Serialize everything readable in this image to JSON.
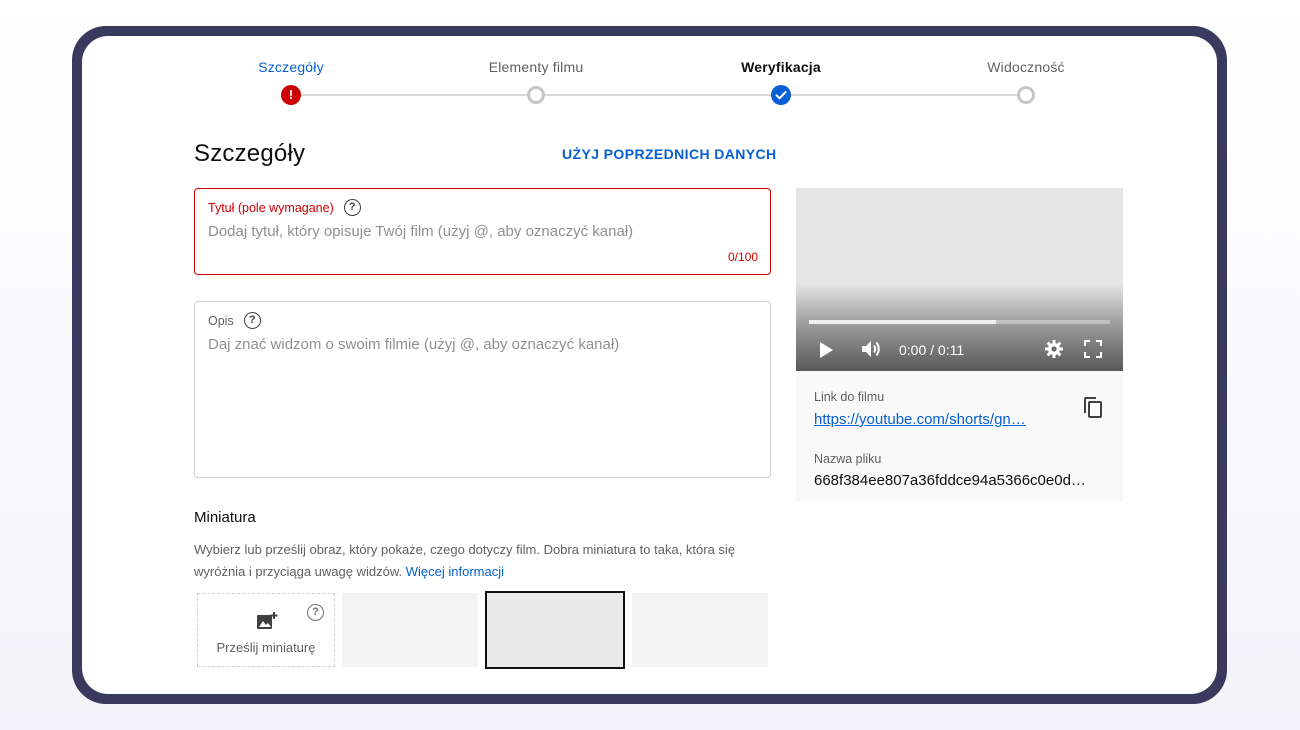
{
  "stepper": {
    "steps": [
      {
        "label": "Szczegóły",
        "state": "error"
      },
      {
        "label": "Elementy filmu",
        "state": "empty"
      },
      {
        "label": "Weryfikacja",
        "state": "done"
      },
      {
        "label": "Widoczność",
        "state": "empty"
      }
    ],
    "error_symbol": "!"
  },
  "page": {
    "title": "Szczegóły",
    "reuse_label": "UŻYJ POPRZEDNICH DANYCH"
  },
  "title_field": {
    "label": "Tytuł (pole wymagane)",
    "placeholder": "Dodaj tytuł, który opisuje Twój film (użyj @, aby oznaczyć kanał)",
    "value": "",
    "counter": "0/100"
  },
  "description_field": {
    "label": "Opis",
    "placeholder": "Daj znać widzom o swoim filmie (użyj @, aby oznaczyć kanał)",
    "value": ""
  },
  "help_symbol": "?",
  "thumbnail": {
    "title": "Miniatura",
    "description": "Wybierz lub prześlij obraz, który pokaże, czego dotyczy film. Dobra miniatura to taka, która się wyróżnia i przyciąga uwagę widzów.",
    "more_info": "Więcej informacji",
    "upload_label": "Prześlij miniaturę"
  },
  "video": {
    "time": "0:00 / 0:11",
    "progress": 0.62,
    "link_label": "Link do filmu",
    "link_value": "https://youtube.com/shorts/gn…",
    "filename_label": "Nazwa pliku",
    "filename_value": "668f384ee807a36fddce94a5366c0e0d…"
  },
  "colors": {
    "accent": "#065fd4",
    "error": "#cc0000",
    "frame": "#3a3a5e"
  }
}
